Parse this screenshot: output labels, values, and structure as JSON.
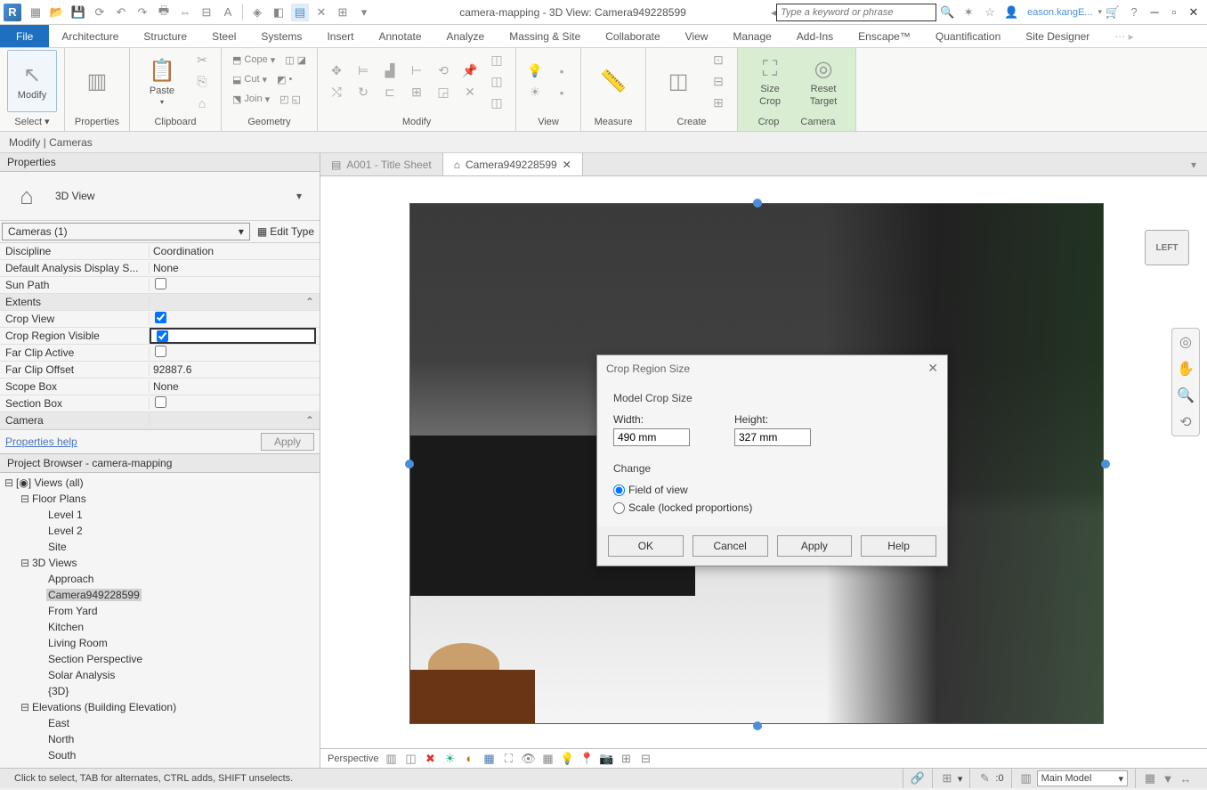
{
  "title_bar": {
    "document_title": "camera-mapping - 3D View: Camera949228599",
    "search_placeholder": "Type a keyword or phrase",
    "user": "eason.kangE..."
  },
  "ribbon": {
    "file": "File",
    "tabs": [
      "Architecture",
      "Structure",
      "Steel",
      "Systems",
      "Insert",
      "Annotate",
      "Analyze",
      "Massing & Site",
      "Collaborate",
      "View",
      "Manage",
      "Add-Ins",
      "Enscape™",
      "Quantification",
      "Site Designer"
    ],
    "panels": {
      "select": {
        "modify": "Modify",
        "select": "Select"
      },
      "properties": {
        "label": "Properties"
      },
      "clipboard": {
        "paste": "Paste",
        "label": "Clipboard"
      },
      "geometry": {
        "cope": "Cope",
        "cut": "Cut",
        "join": "Join",
        "label": "Geometry"
      },
      "modify": {
        "label": "Modify"
      },
      "view": {
        "label": "View"
      },
      "measure": {
        "label": "Measure"
      },
      "create": {
        "label": "Create"
      },
      "crop": {
        "size": "Size",
        "crop": "Crop",
        "reset": "Reset",
        "target": "Target",
        "crop_lbl": "Crop",
        "camera_lbl": "Camera"
      }
    }
  },
  "context_bar": "Modify | Cameras",
  "properties": {
    "header": "Properties",
    "type": "3D View",
    "filter": "Cameras (1)",
    "edit_type": "Edit Type",
    "rows": [
      {
        "label": "Discipline",
        "value": "Coordination",
        "type": "text"
      },
      {
        "label": "Default Analysis Display S...",
        "value": "None",
        "type": "text"
      },
      {
        "label": "Sun Path",
        "value": false,
        "type": "check"
      },
      {
        "label": "Extents",
        "type": "group"
      },
      {
        "label": "Crop View",
        "value": true,
        "type": "check"
      },
      {
        "label": "Crop Region Visible",
        "value": true,
        "type": "check",
        "boxed": true
      },
      {
        "label": "Far Clip Active",
        "value": false,
        "type": "check"
      },
      {
        "label": "Far Clip Offset",
        "value": "92887.6",
        "type": "text"
      },
      {
        "label": "Scope Box",
        "value": "None",
        "type": "text"
      },
      {
        "label": "Section Box",
        "value": false,
        "type": "check"
      },
      {
        "label": "Camera",
        "type": "group"
      }
    ],
    "help_link": "Properties help",
    "apply": "Apply"
  },
  "browser": {
    "header": "Project Browser - camera-mapping",
    "tree": {
      "views": "Views (all)",
      "floor_plans": "Floor Plans",
      "fp_items": [
        "Level 1",
        "Level 2",
        "Site"
      ],
      "three_d": "3D Views",
      "td_items": [
        "Approach",
        "Camera949228599",
        "From Yard",
        "Kitchen",
        "Living Room",
        "Section Perspective",
        "Solar Analysis",
        "{3D}"
      ],
      "td_selected": "Camera949228599",
      "elev": "Elevations (Building Elevation)",
      "elev_items": [
        "East",
        "North",
        "South"
      ]
    }
  },
  "doc_tabs": {
    "a": "A001 - Title Sheet",
    "b": "Camera949228599"
  },
  "nav_cube": "LEFT",
  "dialog": {
    "title": "Crop Region Size",
    "group1": "Model Crop Size",
    "width_lbl": "Width:",
    "width_val": "490 mm",
    "height_lbl": "Height:",
    "height_val": "327 mm",
    "group2": "Change",
    "opt1": "Field of view",
    "opt2": "Scale (locked proportions)",
    "ok": "OK",
    "cancel": "Cancel",
    "apply": "Apply",
    "help": "Help"
  },
  "view_ctrl": {
    "persp": "Perspective"
  },
  "status": {
    "hint": "Click to select, TAB for alternates, CTRL adds, SHIFT unselects.",
    "const": ":0",
    "model": "Main Model"
  }
}
